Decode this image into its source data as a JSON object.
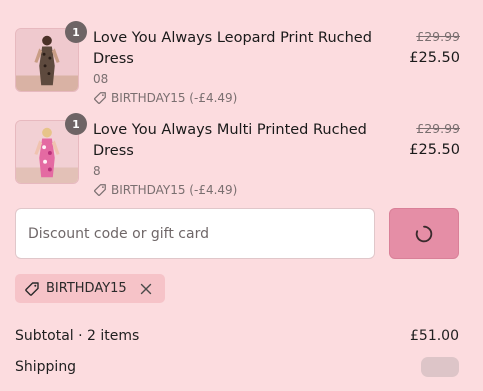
{
  "items": [
    {
      "quantity": "1",
      "name": "Love You Always Leopard Print Ruched Dress",
      "variant": "08",
      "discount": "BIRTHDAY15 (-£4.49)",
      "original_price": "£29.99",
      "price": "£25.50"
    },
    {
      "quantity": "1",
      "name": "Love You Always Multi Printed Ruched Dress",
      "variant": "8",
      "discount": "BIRTHDAY15 (-£4.49)",
      "original_price": "£29.99",
      "price": "£25.50"
    }
  ],
  "discount_form": {
    "placeholder": "Discount code or gift card",
    "value": ""
  },
  "applied_code": {
    "label": "BIRTHDAY15"
  },
  "summary": {
    "subtotal_label": "Subtotal · 2 items",
    "subtotal_value": "£51.00",
    "shipping_label": "Shipping"
  },
  "icons": {
    "tag": "tag-icon",
    "remove": "close-icon",
    "loading": "spinner-icon"
  },
  "colors": {
    "background": "#fcdcdf",
    "accent_button": "#e58ea6",
    "tag_background": "#f6c3c8"
  }
}
